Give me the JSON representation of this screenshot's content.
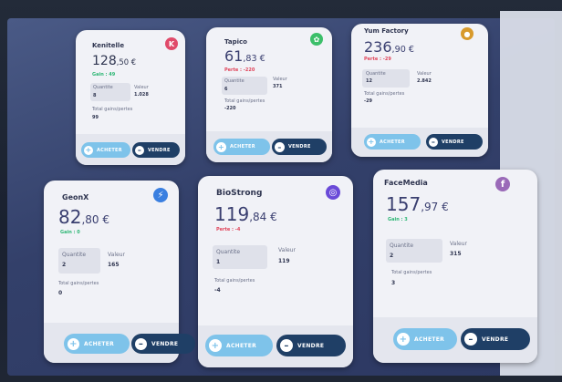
{
  "cards": [
    {
      "name": "Kenitelle",
      "price_int": "128",
      "price_dec": ",50 €",
      "status": "Gain : 49",
      "status_type": "gain",
      "qty_label": "Quantite",
      "qty": "8",
      "val_label": "Valeur",
      "val": "1.028",
      "total_label": "Total gains/pertes",
      "total": "99",
      "buy": "ACHETER",
      "sell": "VENDRE",
      "icon": "K",
      "icon_color": "#e04a6a"
    },
    {
      "name": "Tapico",
      "price_int": "61",
      "price_dec": ",83 €",
      "status": "Perte : -220",
      "status_type": "loss",
      "qty_label": "Quantite",
      "qty": "6",
      "val_label": "Valeur",
      "val": "371",
      "total_label": "Total gains/pertes",
      "total": "-220",
      "buy": "ACHETER",
      "sell": "VENDRE",
      "icon": "✿",
      "icon_color": "#3cbf6a"
    },
    {
      "name": "Yum Factory",
      "price_int": "236",
      "price_dec": ",90 €",
      "status": "Perte : -29",
      "status_type": "loss",
      "qty_label": "Quantite",
      "qty": "12",
      "val_label": "Valeur",
      "val": "2.842",
      "total_label": "Total gains/pertes",
      "total": "-29",
      "buy": "ACHETER",
      "sell": "VENDRE",
      "icon": "●",
      "icon_color": "#d89a2c"
    },
    {
      "name": "GeonX",
      "price_int": "82",
      "price_dec": ",80 €",
      "status": "Gain : 0",
      "status_type": "gain",
      "qty_label": "Quantite",
      "qty": "2",
      "val_label": "Valeur",
      "val": "165",
      "total_label": "Total gains/pertes",
      "total": "0",
      "buy": "ACHETER",
      "sell": "VENDRE",
      "icon": "⚡",
      "icon_color": "#3a7fe0"
    },
    {
      "name": "BioStrong",
      "price_int": "119",
      "price_dec": ",84 €",
      "status": "Perte : -4",
      "status_type": "loss",
      "qty_label": "Quantite",
      "qty": "1",
      "val_label": "Valeur",
      "val": "119",
      "total_label": "Total gains/pertes",
      "total": "-4",
      "buy": "ACHETER",
      "sell": "VENDRE",
      "icon": "◎",
      "icon_color": "#6a4ad8"
    },
    {
      "name": "FaceMedia",
      "price_int": "157",
      "price_dec": ",97 €",
      "status": "Gain : 3",
      "status_type": "gain",
      "qty_label": "Quantite",
      "qty": "2",
      "val_label": "Valeur",
      "val": "315",
      "total_label": "Total gains/pertes",
      "total": "3",
      "buy": "ACHETER",
      "sell": "VENDRE",
      "icon": "f",
      "icon_color": "#9a6ab8"
    }
  ]
}
